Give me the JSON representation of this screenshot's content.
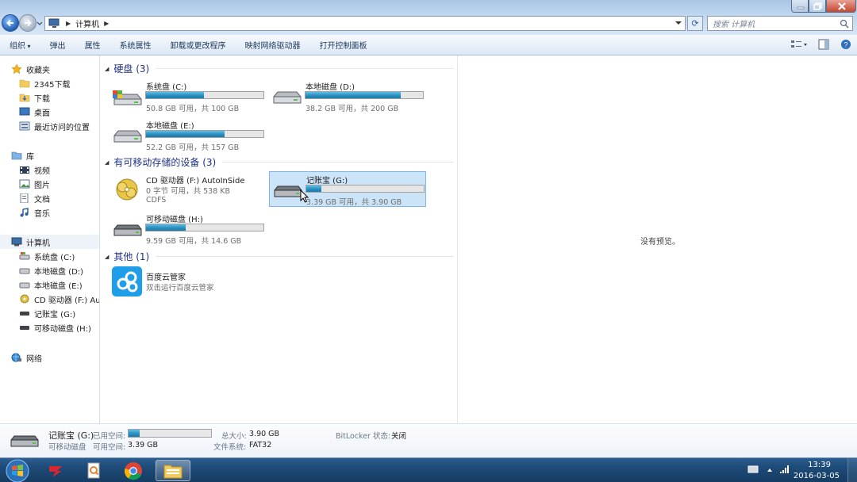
{
  "window": {
    "address": "计算机",
    "search_placeholder": "搜索 计算机"
  },
  "toolbar": {
    "items": [
      "组织",
      "弹出",
      "属性",
      "系统属性",
      "卸载或更改程序",
      "映射网络驱动器",
      "打开控制面板"
    ]
  },
  "sidebar": {
    "favorites_label": "收藏夹",
    "favorites": [
      "2345下载",
      "下载",
      "桌面",
      "最近访问的位置"
    ],
    "libraries_label": "库",
    "libraries": [
      "视频",
      "图片",
      "文档",
      "音乐"
    ],
    "computer_label": "计算机",
    "computer_items": [
      "系统盘 (C:)",
      "本地磁盘 (D:)",
      "本地磁盘 (E:)",
      "CD 驱动器 (F:) AutoInSide",
      "记账宝 (G:)",
      "可移动磁盘 (H:)"
    ],
    "network_label": "网络"
  },
  "groups": {
    "hard_disks": "硬盘 (3)",
    "removable": "有可移动存储的设备 (3)",
    "other": "其他 (1)"
  },
  "drives": {
    "c": {
      "name": "系统盘 (C:)",
      "info": "50.8 GB 可用，共 100 GB",
      "used_fraction": 0.49
    },
    "d": {
      "name": "本地磁盘 (D:)",
      "info": "38.2 GB 可用，共 200 GB",
      "used_fraction": 0.81
    },
    "e": {
      "name": "本地磁盘 (E:)",
      "info": "52.2 GB 可用，共 157 GB",
      "used_fraction": 0.67
    },
    "f": {
      "name": "CD 驱动器 (F:) AutoInSide",
      "info": "0 字节 可用，共 538 KB",
      "fs": "CDFS"
    },
    "g": {
      "name": "记账宝 (G:)",
      "info": "3.39 GB 可用，共 3.90 GB",
      "used_fraction": 0.13
    },
    "h": {
      "name": "可移动磁盘 (H:)",
      "info": "9.59 GB 可用，共 14.6 GB",
      "used_fraction": 0.34
    }
  },
  "other_item": {
    "name": "百度云管家",
    "desc": "双击运行百度云管家"
  },
  "preview": {
    "text": "没有预览。"
  },
  "details": {
    "name": "记账宝 (G:)",
    "type": "可移动磁盘",
    "used_label": "已用空间:",
    "used_fraction": 0.13,
    "free_label": "可用空间:",
    "free_value": "3.39 GB",
    "total_label": "总大小:",
    "total_value": "3.90 GB",
    "fs_label": "文件系统:",
    "fs_value": "FAT32",
    "bitlocker_label": "BitLocker 状态:",
    "bitlocker_value": "关闭"
  },
  "taskbar": {
    "time": "13:39",
    "date": "2016-03-05"
  }
}
